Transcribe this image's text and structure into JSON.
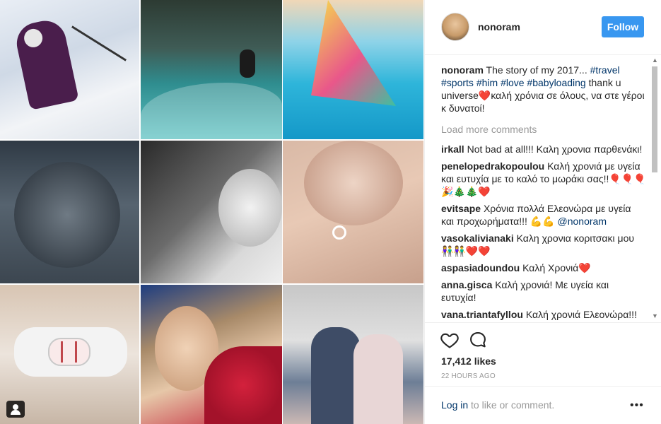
{
  "post": {
    "username": "nonoram",
    "follow_label": "Follow"
  },
  "caption": {
    "user": "nonoram",
    "text_before": "The story of my 2017... ",
    "tags": [
      "#travel",
      "#sports",
      "#him",
      "#love",
      "#babyloading"
    ],
    "text_after": " thank u universe❤️καλή χρόνια σε όλους, να στε γέροι κ δυνατοί!"
  },
  "load_more": "Load more comments",
  "comments": [
    {
      "user": "irkall",
      "text": "Not bad at all!!! Καλη χρονια παρθενάκι!"
    },
    {
      "user": "penelopedrakopoulou",
      "text": "Καλή χρονιά με υγεία και ευτυχία με το καλό το μωράκι σας!!🎈🎈🎈🎉🎄🎄❤️"
    },
    {
      "user": "evitsape",
      "text": "Χρόνια πολλά Ελεονώρα με υγεία και προχωρήματα!!! 💪💪",
      "mention": "@nonoram"
    },
    {
      "user": "vasokalivianaki",
      "text": "Καλη χρονια κοριτσακι μου👫👫❤️❤️"
    },
    {
      "user": "aspasiadoundou",
      "text": "Καλή Χρονιά❤️"
    },
    {
      "user": "anna.gisca",
      "text": "Καλή χρονιά! Με υγεία και ευτυχία!"
    },
    {
      "user": "vana.triantafyllou",
      "text": "Καλή χρονιά Ελεονώρα!!!"
    }
  ],
  "likes": "17,412 likes",
  "time": "22 HOURS AGO",
  "login": {
    "link": "Log in",
    "text": " to like or comment."
  },
  "more_icon": "•••",
  "icons": [
    "heart-icon",
    "comment-icon",
    "user-tag-icon",
    "more-options-icon"
  ]
}
